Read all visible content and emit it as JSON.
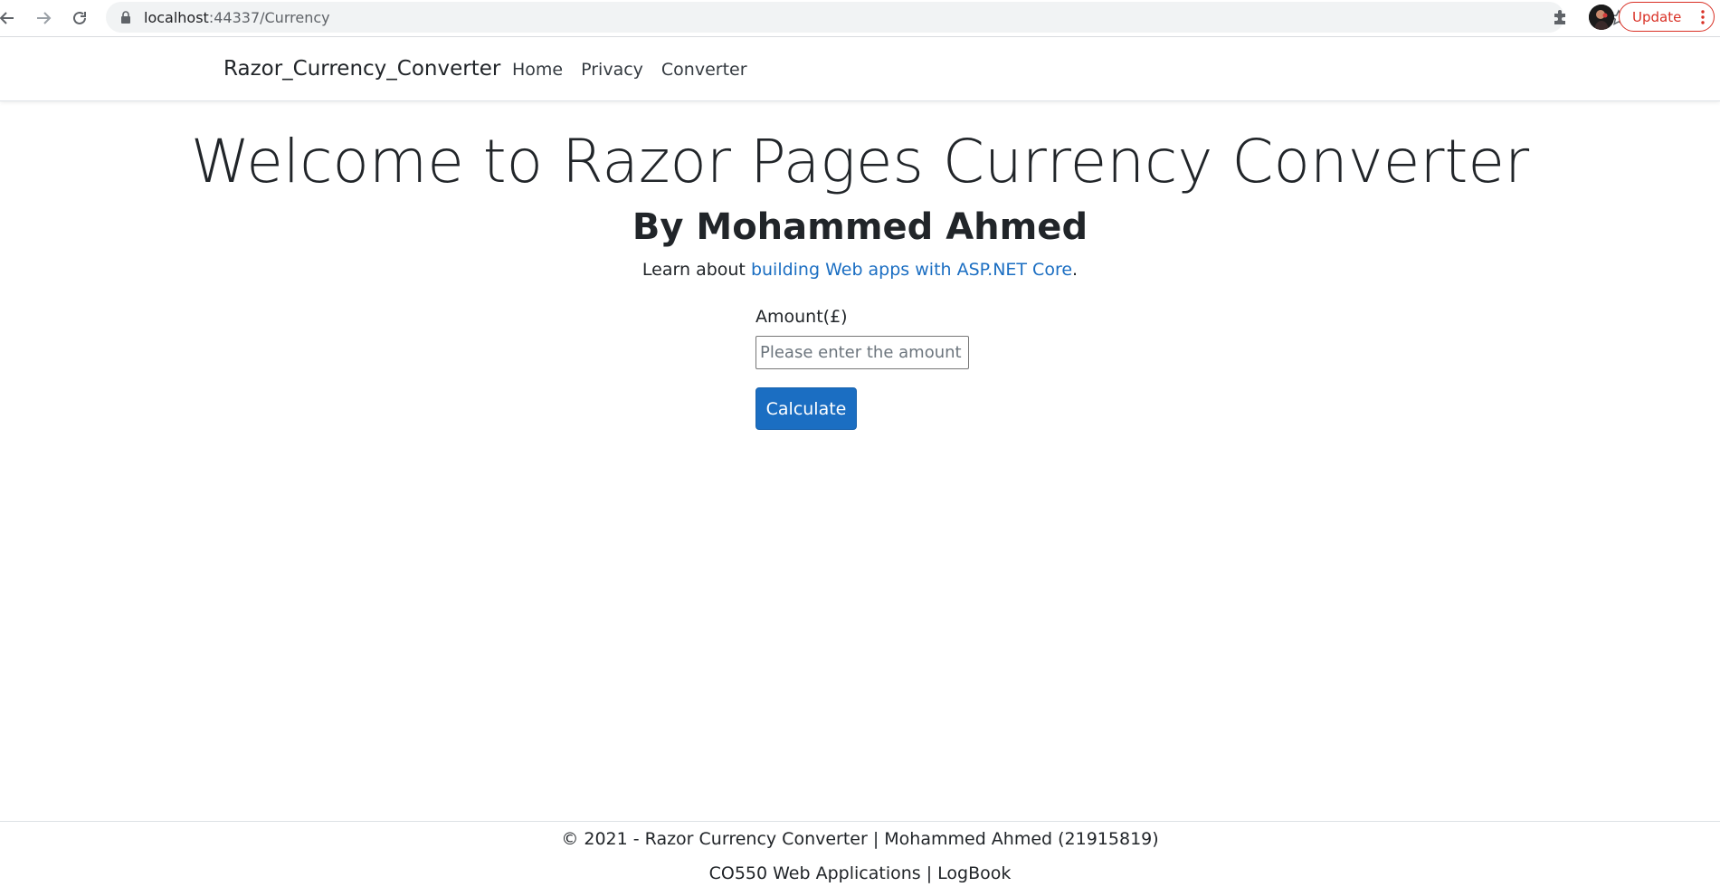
{
  "browser": {
    "url_host": "localhost",
    "url_path": ":44337/Currency",
    "update_label": "Update"
  },
  "navbar": {
    "brand": "Razor_Currency_Converter",
    "links": [
      "Home",
      "Privacy",
      "Converter"
    ]
  },
  "main": {
    "title": "Welcome to Razor Pages Currency Converter",
    "subtitle": "By Mohammed Ahmed",
    "learn_prefix": "Learn about ",
    "learn_link": "building Web apps with ASP.NET Core",
    "learn_suffix": "."
  },
  "form": {
    "amount_label": "Amount(£)",
    "amount_placeholder": "Please enter the amount you wish to convert",
    "amount_value": "",
    "calculate_label": "Calculate"
  },
  "footer": {
    "line1": "© 2021 - Razor Currency Converter | Mohammed Ahmed (21915819)",
    "line2": "CO550 Web Applications | LogBook"
  },
  "colors": {
    "accent": "#1b6ec2",
    "update_red": "#d93025"
  },
  "icons": {
    "back": "arrow-left-icon",
    "forward": "arrow-right-icon",
    "reload": "reload-icon",
    "lock": "lock-icon",
    "bookmark": "star-icon",
    "extensions": "puzzle-icon",
    "profile": "avatar",
    "menu": "kebab-menu-icon"
  }
}
